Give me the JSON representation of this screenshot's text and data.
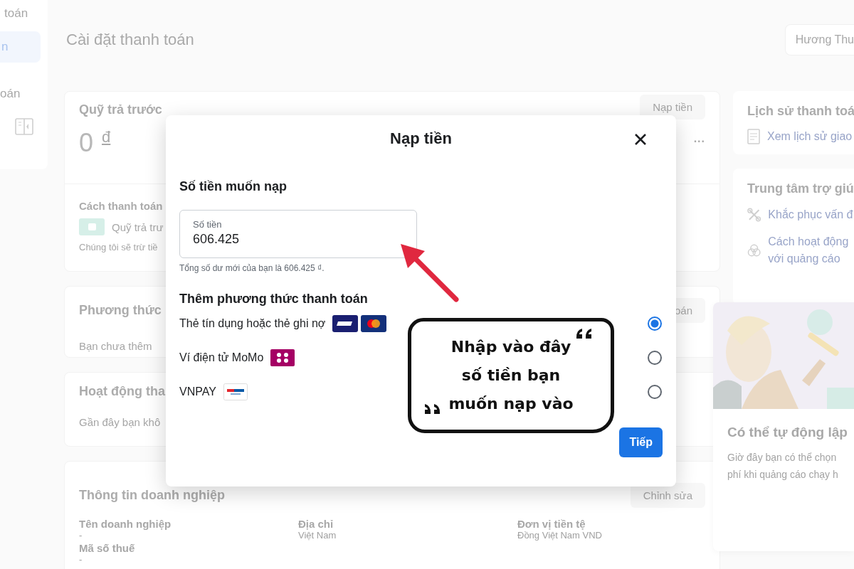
{
  "sidebar": {
    "items": [
      {
        "label": "toán",
        "selected": false
      },
      {
        "label": "n",
        "selected": true
      },
      {
        "label": "oán",
        "selected": false
      }
    ]
  },
  "header": {
    "title": "Cài đặt thanh toán",
    "account": "Hương Thu"
  },
  "prepaid_card": {
    "title": "Quỹ trả trước",
    "button": "Nạp tiền",
    "balance": "0",
    "currency": "đ",
    "more": "...",
    "method_title": "Cách thanh toán",
    "method": "Quỹ trả trư",
    "note": "Chúng tôi sẽ trừ tiề"
  },
  "payment_methods_card": {
    "title": "Phương thức",
    "button": "oán",
    "text": "Bạn chưa thêm"
  },
  "activity_card": {
    "title": "Hoạt động tha",
    "text": "Gần đây bạn khô"
  },
  "business_card": {
    "title": "Thông tin doanh nghiệp",
    "button": "Chỉnh sửa",
    "fields": [
      {
        "label": "Tên doanh nghiệp",
        "value": "-"
      },
      {
        "label": "Địa chỉ",
        "value": "Việt Nam"
      },
      {
        "label": "Đơn vị tiền tệ",
        "value": "Đồng Việt Nam VND"
      },
      {
        "label": "Mã số thuế",
        "value": "-"
      }
    ]
  },
  "history_card": {
    "title": "Lịch sử thanh toá",
    "link": "Xem lịch sử giao"
  },
  "help_card": {
    "title": "Trung tâm trợ giú",
    "links": [
      {
        "kind": "fix",
        "label": "Khắc phục vấn đ"
      },
      {
        "kind": "how",
        "label": "Cách hoạt động với quảng cáo"
      }
    ]
  },
  "promo_card": {
    "picture": {
      "kind": "picture"
    },
    "title": "Có thể tự động lập",
    "text_lines": [
      "Giờ đây bạn có thể chọn",
      "phí khi quảng cáo chạy h"
    ]
  },
  "dialog": {
    "title": "Nạp tiền",
    "amount_section": "Số tiền muốn nạp",
    "amount_field": {
      "label": "Số tiền",
      "value": "606.425"
    },
    "helper": "Tổng số dư mới của bạn là 606.425 ₫.",
    "methods_title": "Thêm phương thức thanh toán",
    "methods": [
      {
        "label": "Thẻ tín dụng hoặc thẻ ghi nợ",
        "kind": "card",
        "selected": true
      },
      {
        "label": "Ví điện tử MoMo",
        "kind": "momo",
        "selected": false
      },
      {
        "label": "VNPAY",
        "kind": "vnpay",
        "selected": false
      }
    ],
    "next_button": "Tiếp"
  },
  "annotation": {
    "text_lines": [
      "Nhập vào đây",
      "số tiền bạn",
      "muốn nạp vào"
    ]
  }
}
